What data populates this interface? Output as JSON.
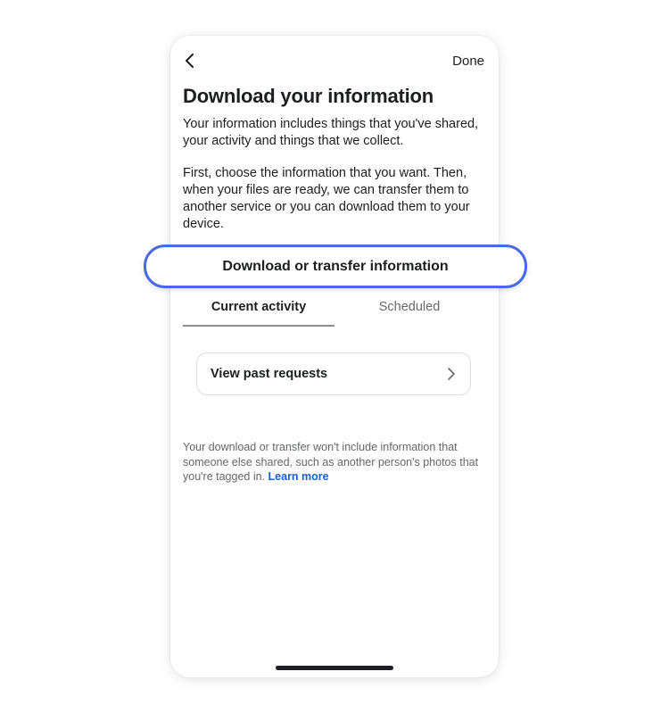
{
  "header": {
    "done_label": "Done"
  },
  "page": {
    "title": "Download your information",
    "intro": "Your information includes things that you've shared, your activity and things that we collect.",
    "instructions": "First, choose the information that you want. Then, when your files are ready, we can transfer them to another service or you can download them to your device."
  },
  "cta": {
    "label": "Download or transfer information"
  },
  "tabs": [
    {
      "label": "Current activity"
    },
    {
      "label": "Scheduled"
    }
  ],
  "card": {
    "label": "View past requests"
  },
  "note": {
    "text": "Your download or transfer won't include information that someone else shared, such as another person's photos that you're tagged in.",
    "link": "Learn more"
  },
  "icons": {
    "back": "chevron-left-icon",
    "card_chevron": "chevron-right-icon"
  },
  "colors": {
    "highlight": "#4a69e8",
    "link": "#1a5fd1",
    "secondary_text": "#65676b"
  }
}
